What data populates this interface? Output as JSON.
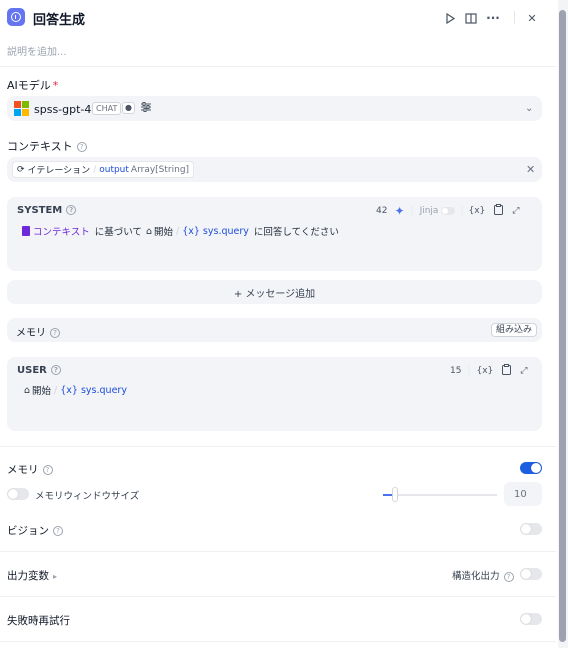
{
  "header": {
    "title": "回答生成",
    "run_icon": "play-icon",
    "split_icon": "book-open-icon",
    "more_label": "···",
    "close_label": "✕"
  },
  "description_placeholder": "説明を追加...",
  "ai_model": {
    "label": "AIモデル",
    "required_mark": "*",
    "model_name": "spss-gpt-4o",
    "mode_chip": "CHAT",
    "brand_colors": [
      "#f25022",
      "#7fba00",
      "#00a4ef",
      "#ffb900"
    ]
  },
  "context": {
    "label": "コンテキスト",
    "node_name": "イテレーション",
    "variable": "output",
    "type": "Array[String]"
  },
  "system_prompt": {
    "title": "SYSTEM",
    "token_count": "42",
    "jinja_label": "Jinja",
    "var_button": "{x}",
    "text": {
      "context_ref": "コンテキスト",
      "after_context": "に基づいて",
      "start_node": "開始",
      "query_var": "{x} sys.query",
      "tail": "に回答してください"
    }
  },
  "add_message_label": "+ メッセージ追加",
  "memory_block": {
    "label": "メモリ",
    "builtin_button": "組み込み"
  },
  "user_prompt": {
    "title": "USER",
    "token_count": "15",
    "var_button": "{x}",
    "start_node": "開始",
    "query_var": "{x} sys.query"
  },
  "memory_settings": {
    "label": "メモリ",
    "enabled": true,
    "window_label": "メモリウィンドウサイズ",
    "window_enabled": false,
    "window_value": "10",
    "window_level_fraction": 0.1
  },
  "vision": {
    "label": "ビジョン",
    "enabled": false
  },
  "output_vars": {
    "label": "出力変数",
    "structured_label": "構造化出力",
    "structured_enabled": false
  },
  "retry": {
    "label": "失敗時再試行",
    "enabled": false
  },
  "accent_color": "#1d5fe3"
}
